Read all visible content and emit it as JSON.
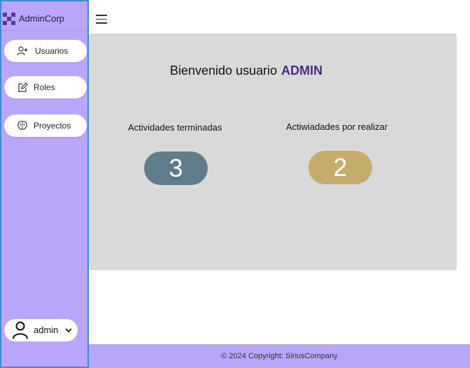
{
  "sidebar": {
    "brand": "AdminCorp",
    "items": [
      {
        "label": "Usuarios",
        "icon": "user-plus-icon"
      },
      {
        "label": "Roles",
        "icon": "edit-icon"
      },
      {
        "label": "Proyectos",
        "icon": "brain-icon"
      }
    ],
    "user": {
      "name": "admin",
      "icon": "user-icon"
    }
  },
  "main": {
    "welcome_text": "Bienvenido usuario",
    "welcome_user": "ADMIN",
    "stats": [
      {
        "label": "Actividades terminadas",
        "value": "3",
        "color": "#607d8b"
      },
      {
        "label": "Actiwiadades por realizar",
        "value": "2",
        "color": "#c4ad6a"
      }
    ]
  },
  "footer": {
    "text": "© 2024 Copyright: SiriusCompany"
  },
  "colors": {
    "sidebar": "#b9a6fb",
    "accent": "#4a2d7c",
    "card": "#d9d9d9"
  }
}
